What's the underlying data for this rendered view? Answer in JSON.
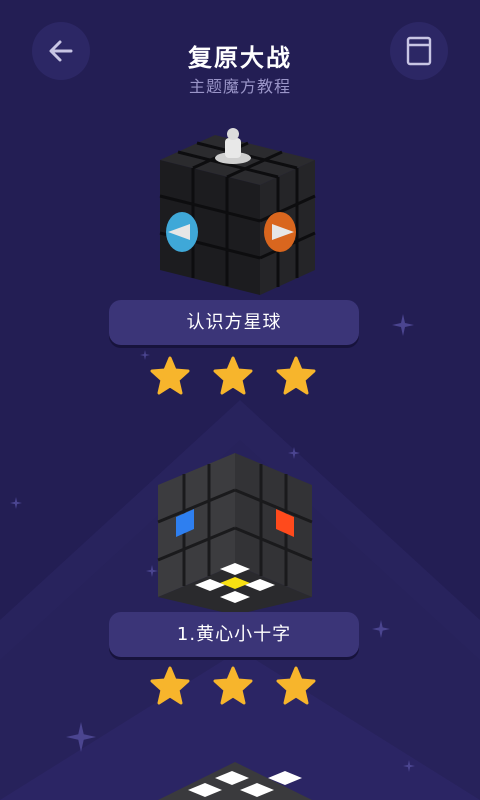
{
  "header": {
    "title": "复原大战",
    "subtitle": "主题魔方教程"
  },
  "icons": {
    "back": "arrow-left-icon",
    "book": "book-icon"
  },
  "colors": {
    "background": "#231e54",
    "button_bg": "#2c2765",
    "label_bg": "#3b3578",
    "star": "#f7b52c",
    "subtitle": "#9a95c8"
  },
  "levels": [
    {
      "label": "认识方星球",
      "stars": 3
    },
    {
      "label": "1.黄心小十字",
      "stars": 3
    },
    {
      "label": "",
      "stars": 0
    }
  ]
}
